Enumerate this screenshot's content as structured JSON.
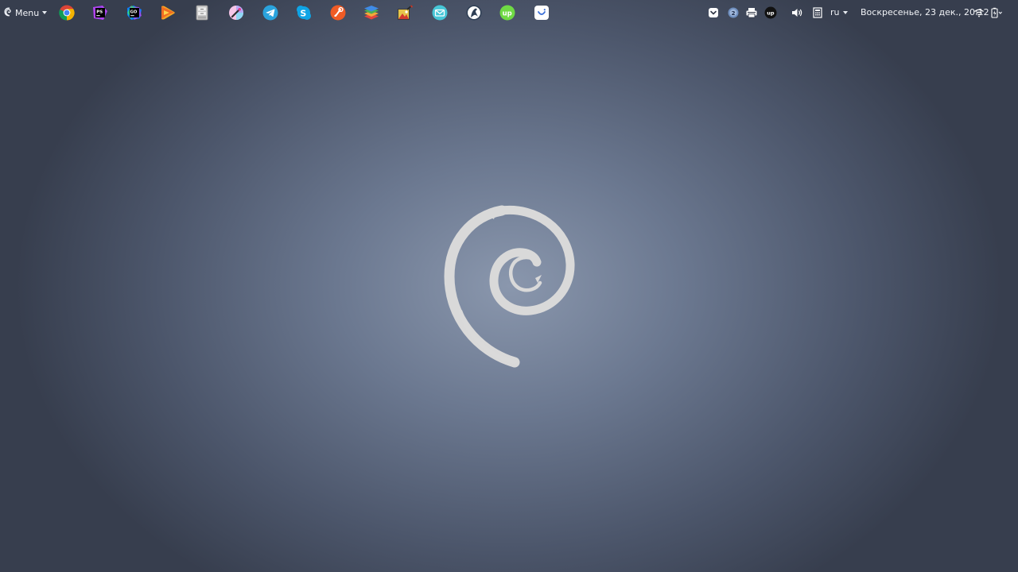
{
  "panel": {
    "menu_label": "Menu",
    "launchers": [
      {
        "name": "chrome-icon"
      },
      {
        "name": "phpstorm-icon"
      },
      {
        "name": "goland-icon"
      },
      {
        "name": "player-icon"
      },
      {
        "name": "file-manager-icon"
      },
      {
        "name": "color-picker-icon"
      },
      {
        "name": "telegram-icon"
      },
      {
        "name": "skype-icon"
      },
      {
        "name": "postman-icon"
      },
      {
        "name": "layers-app-icon"
      },
      {
        "name": "image-editor-icon"
      },
      {
        "name": "mail-icon"
      },
      {
        "name": "hub-icon"
      },
      {
        "name": "upwork-icon"
      },
      {
        "name": "smile-app-icon"
      }
    ],
    "tray": {
      "language": "ru",
      "clock": "Воскресенье, 23 дек., 20:12"
    }
  },
  "colors": {
    "desktop_center": "#8a97ad",
    "desktop_edge": "#373e4e",
    "logo": "#d9d9d9"
  }
}
